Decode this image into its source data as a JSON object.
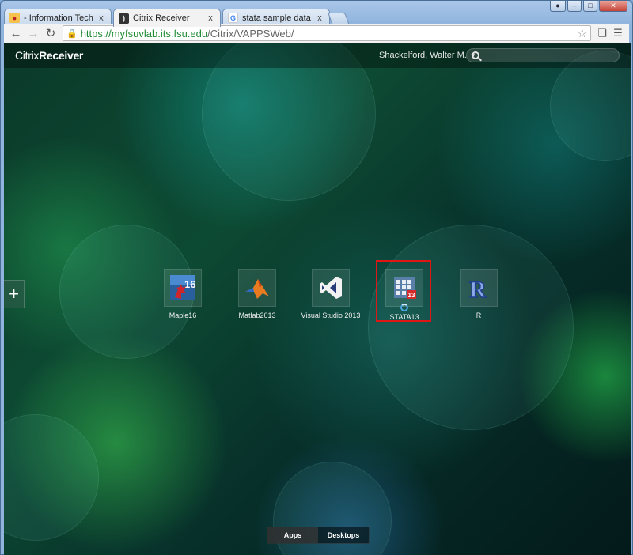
{
  "browser": {
    "tabs": [
      {
        "title": "- Information Technology",
        "icon": "globe-icon",
        "active": false
      },
      {
        "title": "Citrix Receiver",
        "icon": "citrix-icon",
        "active": true
      },
      {
        "title": "stata sample data sets - Go",
        "icon": "google-icon",
        "active": false
      }
    ],
    "close_glyph": "x",
    "url_secure": "https://myfsuvlab.its.fsu.edu",
    "url_path": "/Citrix/VAPPSWeb/"
  },
  "header": {
    "logo_light": "Citrix",
    "logo_bold": "Receiver",
    "username": "Shackelford, Walter M.",
    "search_placeholder": ""
  },
  "apps": [
    {
      "name": "Maple16",
      "icon": "maple-icon"
    },
    {
      "name": "Matlab2013",
      "icon": "matlab-icon"
    },
    {
      "name": "Visual Studio 2013",
      "icon": "visual-studio-icon"
    },
    {
      "name": "STATA13",
      "icon": "stata-icon",
      "badge": "13"
    },
    {
      "name": "R",
      "icon": "r-icon"
    }
  ],
  "bottom_tabs": [
    {
      "label": "Apps",
      "active": true
    },
    {
      "label": "Desktops",
      "active": false
    }
  ],
  "colors": {
    "highlight": "#e01515",
    "secure_url": "#1e8a32"
  }
}
